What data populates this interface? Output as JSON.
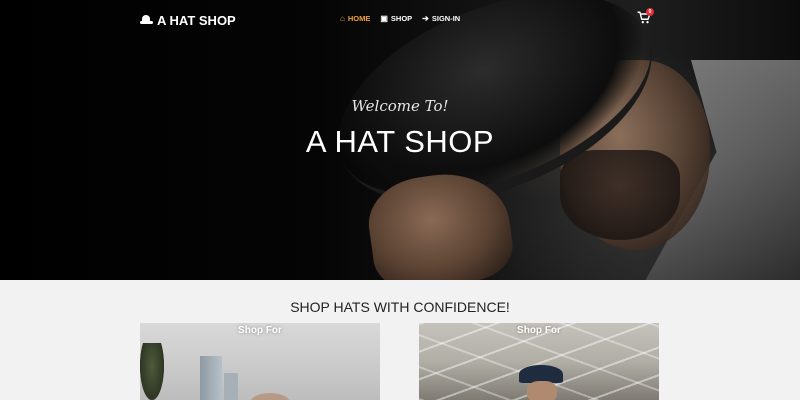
{
  "nav": {
    "brand": "A HAT SHOP",
    "brand_icon": "hat-icon",
    "items": [
      {
        "label": "HOME",
        "icon": "home-icon",
        "active": true
      },
      {
        "label": "SHOP",
        "icon": "shopping-bag-icon",
        "active": false
      },
      {
        "label": "SIGN-IN",
        "icon": "sign-in-icon",
        "active": false
      }
    ],
    "cart_icon": "cart-icon",
    "cart_count": "0"
  },
  "hero": {
    "welcome": "Welcome To!",
    "title": "A HAT SHOP"
  },
  "section": {
    "title": "SHOP HATS WITH CONFIDENCE!"
  },
  "cards": [
    {
      "label": "Shop For"
    },
    {
      "label": "Shop For"
    }
  ],
  "colors": {
    "active_nav": "#f0a23a",
    "badge": "#e0303a",
    "section_bg": "#f2f2f2"
  }
}
